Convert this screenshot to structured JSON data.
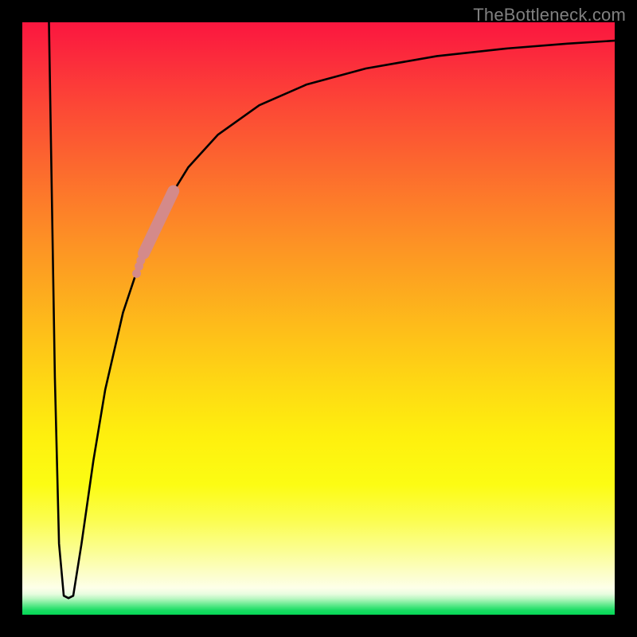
{
  "watermark": "TheBottleneck.com",
  "chart_data": {
    "type": "line",
    "title": "",
    "xlabel": "",
    "ylabel": "",
    "xlim": [
      0,
      100
    ],
    "ylim": [
      0,
      100
    ],
    "grid": false,
    "gradient_stops": [
      {
        "pos": 0.0,
        "color": "#fb163f"
      },
      {
        "pos": 0.5,
        "color": "#fdb81b"
      },
      {
        "pos": 0.78,
        "color": "#fcfc13"
      },
      {
        "pos": 0.93,
        "color": "#fcfec8"
      },
      {
        "pos": 1.0,
        "color": "#06d957"
      }
    ],
    "curve": [
      {
        "x": 4.5,
        "y": 100.0
      },
      {
        "x": 5.0,
        "y": 70.0
      },
      {
        "x": 5.5,
        "y": 40.0
      },
      {
        "x": 6.2,
        "y": 12.0
      },
      {
        "x": 7.0,
        "y": 3.2
      },
      {
        "x": 7.8,
        "y": 2.8
      },
      {
        "x": 8.6,
        "y": 3.2
      },
      {
        "x": 10.0,
        "y": 12.0
      },
      {
        "x": 12.0,
        "y": 26.0
      },
      {
        "x": 14.0,
        "y": 38.0
      },
      {
        "x": 17.0,
        "y": 51.0
      },
      {
        "x": 20.0,
        "y": 60.0
      },
      {
        "x": 24.0,
        "y": 69.0
      },
      {
        "x": 28.0,
        "y": 75.5
      },
      {
        "x": 33.0,
        "y": 81.0
      },
      {
        "x": 40.0,
        "y": 86.0
      },
      {
        "x": 48.0,
        "y": 89.5
      },
      {
        "x": 58.0,
        "y": 92.2
      },
      {
        "x": 70.0,
        "y": 94.3
      },
      {
        "x": 82.0,
        "y": 95.6
      },
      {
        "x": 92.0,
        "y": 96.4
      },
      {
        "x": 100.0,
        "y": 96.9
      }
    ],
    "thick_band": {
      "start": {
        "x": 20.5,
        "y": 61.0
      },
      "end": {
        "x": 25.5,
        "y": 71.5
      },
      "color": "#d48a8a"
    },
    "dot_cluster": [
      {
        "x": 19.3,
        "y": 57.6
      },
      {
        "x": 19.7,
        "y": 58.8
      },
      {
        "x": 20.0,
        "y": 59.8
      }
    ]
  }
}
